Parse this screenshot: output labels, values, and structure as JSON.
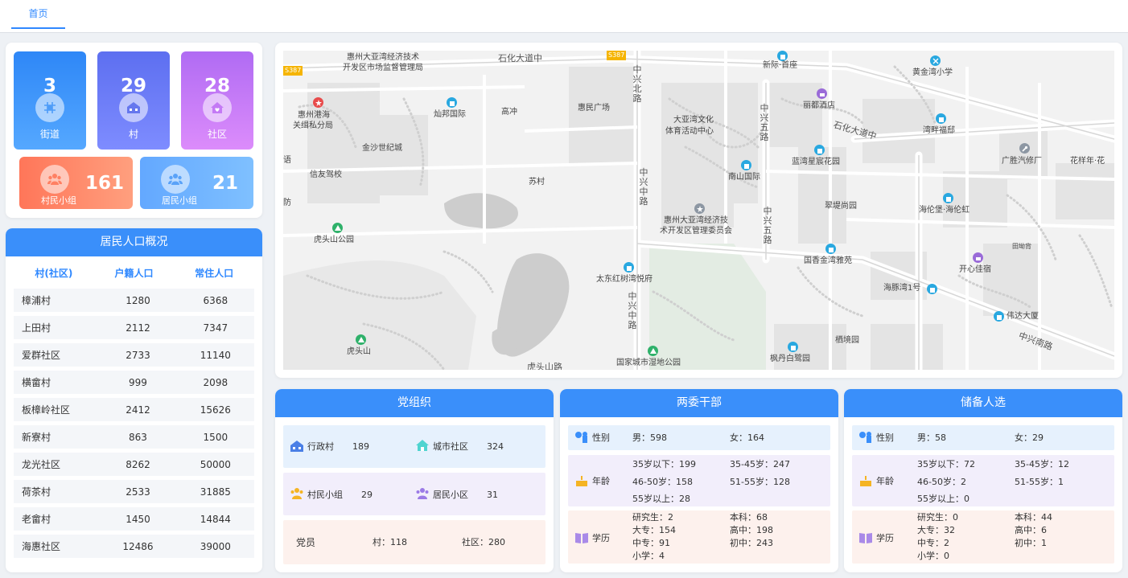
{
  "tabs": {
    "home": "首页"
  },
  "stats": [
    {
      "value": "3",
      "label": "街道"
    },
    {
      "value": "29",
      "label": "村"
    },
    {
      "value": "28",
      "label": "社区"
    },
    {
      "value": "161",
      "label": "村民小组"
    },
    {
      "value": "21",
      "label": "居民小组"
    }
  ],
  "population": {
    "title": "居民人口概况",
    "columns": [
      "村(社区)",
      "户籍人口",
      "常住人口"
    ],
    "rows": [
      [
        "樟浦村",
        "1280",
        "6368"
      ],
      [
        "上田村",
        "2112",
        "7347"
      ],
      [
        "爱群社区",
        "2733",
        "11140"
      ],
      [
        "横畲村",
        "999",
        "2098"
      ],
      [
        "板樟岭社区",
        "2412",
        "15626"
      ],
      [
        "新寮村",
        "863",
        "1500"
      ],
      [
        "龙光社区",
        "8262",
        "50000"
      ],
      [
        "荷茶村",
        "2533",
        "31885"
      ],
      [
        "老畲村",
        "1450",
        "14844"
      ],
      [
        "海惠社区",
        "12486",
        "39000"
      ]
    ]
  },
  "map": {
    "roads": {
      "shihua_n": "石化大道中",
      "shihua_e": "石化大道中",
      "zhongxing_n": "中兴北路",
      "zhongxing_mid": "中兴中路",
      "zhongxing_s": "中兴中路",
      "zhongxing5_n": "中兴五路",
      "zhongxing5_s": "中兴五路",
      "zhongxingnan": "中兴南路",
      "huxian": "虎头山路",
      "s387": "S387",
      "s387b": "S387"
    },
    "labels": {
      "l1": "惠州大亚湾经济技术",
      "l1b": "开发区市场监督管理局",
      "l2": "惠州港海",
      "l2b": "关缉私分局",
      "l3": "灿邦国际",
      "l4": "高冲",
      "l5": "惠民广场",
      "l6": "大亚湾文化",
      "l6b": "体育活动中心",
      "l7": "金沙世纪城",
      "l8": "信友驾校",
      "l9": "苏村",
      "l10": "南山国际",
      "l11": "蓝湾星宸花园",
      "l12": "翠堤尚园",
      "l13": "惠州大亚湾经济技",
      "l13b": "术开发区管理委员会",
      "l14": "虎头山公园",
      "l15": "太东红树湾悦府",
      "l16": "国香金湾雅苑",
      "l17": "海豚湾1号",
      "l18": "虎头山",
      "l19": "国家城市湿地公园",
      "l20": "枫丹白鹭园",
      "l21": "栖境园",
      "l22": "新际·首座",
      "l23": "丽都酒店",
      "l24": "黄金湾小学",
      "l25": "湾畔福邸",
      "l26": "广胜汽修厂",
      "l27": "花样年·花",
      "l28": "海伦堡·海伦虹",
      "l29": "田坳背",
      "l30": "开心佳宿",
      "l31": "伟达大厦",
      "l32": "语",
      "l33": "防"
    }
  },
  "party": {
    "title": "党组织",
    "admin_village_label": "行政村",
    "admin_village_value": "189",
    "city_community_label": "城市社区",
    "city_community_value": "324",
    "villager_group_label": "村民小组",
    "villager_group_value": "29",
    "resident_group_label": "居民小区",
    "resident_group_value": "31",
    "member_label": "党员",
    "member_village": "村：118",
    "member_community": "社区：280"
  },
  "cadre": {
    "title": "两委干部",
    "gender_label": "性别",
    "male": "男：598",
    "female": "女：164",
    "age_label": "年龄",
    "age_1": "35岁以下：199",
    "age_2": "35-45岁：247",
    "age_3": "46-50岁：158",
    "age_4": "51-55岁：128",
    "age_5": "55岁以上：28",
    "edu_label": "学历",
    "edu_1": "研究生：2",
    "edu_2": "本科：68",
    "edu_3": "大专：154",
    "edu_4": "高中：198",
    "edu_5": "中专：91",
    "edu_6": "初中：243",
    "edu_7": "小学：4"
  },
  "reserve": {
    "title": "储备人选",
    "gender_label": "性别",
    "male": "男：58",
    "female": "女：29",
    "age_label": "年龄",
    "age_1": "35岁以下：72",
    "age_2": "35-45岁：12",
    "age_3": "46-50岁：2",
    "age_4": "51-55岁：1",
    "age_5": "55岁以上：0",
    "edu_label": "学历",
    "edu_1": "研究生：0",
    "edu_2": "本科：44",
    "edu_3": "大专：32",
    "edu_4": "高中：6",
    "edu_5": "中专：2",
    "edu_6": "初中：1",
    "edu_7": "小学：0"
  }
}
